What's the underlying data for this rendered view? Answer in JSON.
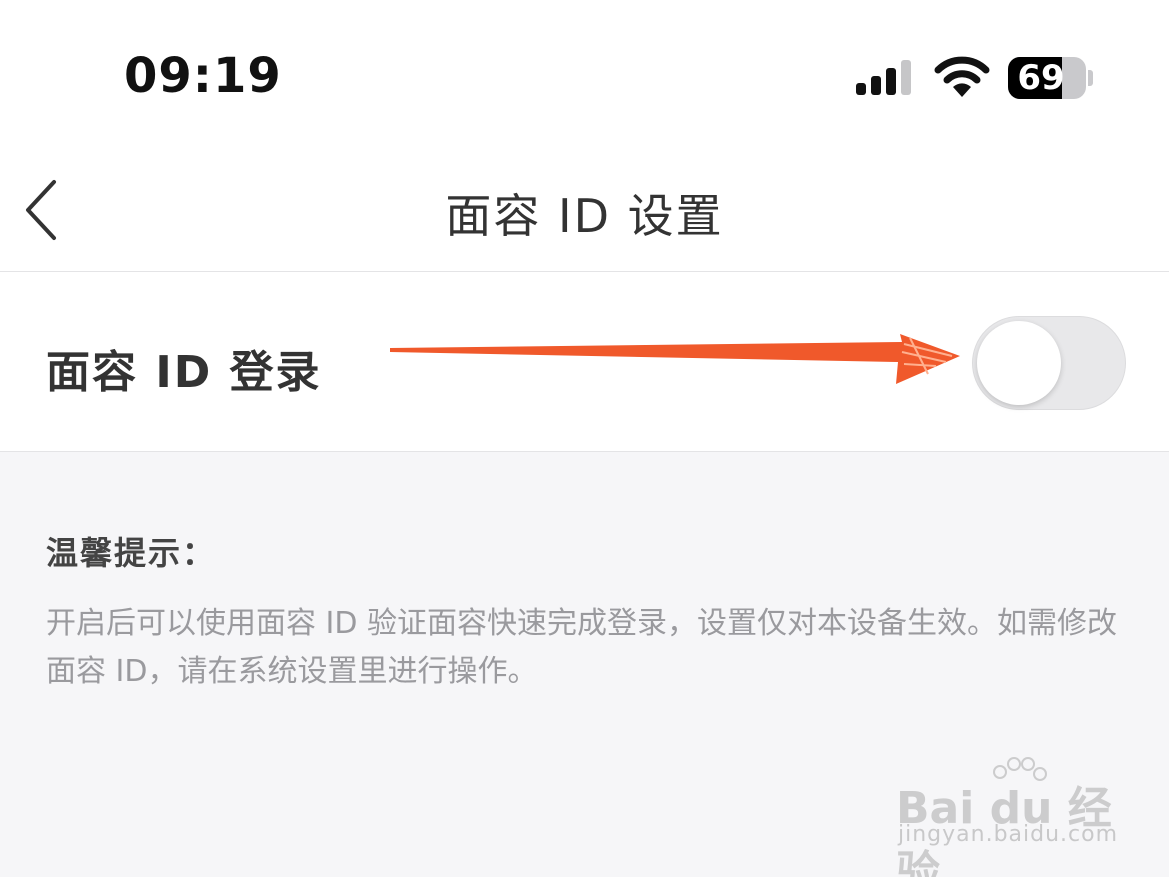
{
  "status_bar": {
    "time": "09:19",
    "battery_level": "69",
    "battery_fraction": 0.69,
    "signal_icon": "cellular-signal-icon",
    "wifi_icon": "wifi-icon"
  },
  "nav": {
    "title": "面容 ID 设置",
    "back_icon": "chevron-left-icon"
  },
  "setting": {
    "label": "面容 ID 登录",
    "toggle_on": false
  },
  "tips": {
    "title": "温馨提示：",
    "body": "开启后可以使用面容 ID 验证面容快速完成登录，设置仅对本设备生效。如需修改面容 ID，请在系统设置里进行操作。"
  },
  "watermark": {
    "brand": "Bai du 经验",
    "url": "jingyan.baidu.com"
  },
  "colors": {
    "annotation_arrow": "#f0592b",
    "toggle_off": "#e8e8ea",
    "background": "#f6f6f8"
  }
}
